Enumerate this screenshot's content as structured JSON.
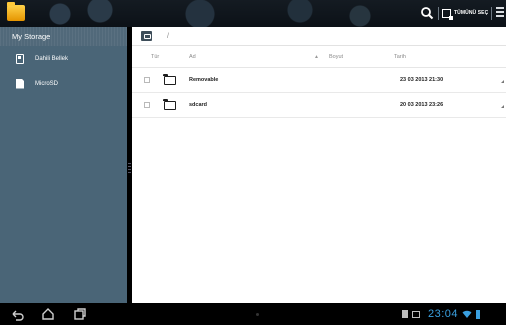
{
  "topbar": {
    "app_icon": "file-manager-folder-icon",
    "search_icon": "search-icon",
    "select_all_label": "TÜMÜNÜ SEÇ",
    "menu_icon": "overflow-menu-icon"
  },
  "sidebar": {
    "header": "My Storage",
    "items": [
      {
        "label": "Dahili Bellek",
        "icon": "internal-storage-icon"
      },
      {
        "label": "MicroSD",
        "icon": "sd-card-icon"
      }
    ]
  },
  "main": {
    "path": "/",
    "columns": {
      "type": "Tür",
      "name": "Ad",
      "size": "Boyut",
      "date": "Tarih"
    },
    "sort_indicator": "▲",
    "rows": [
      {
        "name": "Removable",
        "date": "23 03 2013 21:30"
      },
      {
        "name": "sdcard",
        "date": "20 03 2013 23:26"
      }
    ]
  },
  "navbar": {
    "clock": "23:04",
    "status_color": "#3aa0e0"
  }
}
